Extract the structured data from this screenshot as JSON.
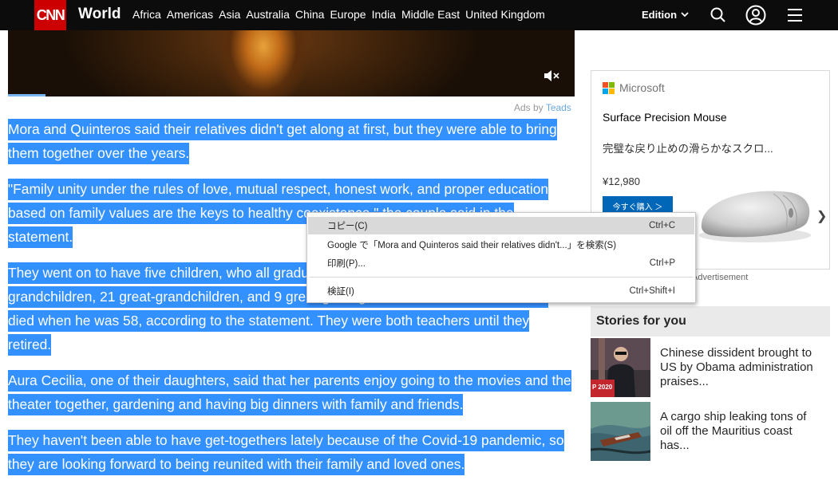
{
  "nav": {
    "logo": "CNN",
    "section": "World",
    "links": [
      "Africa",
      "Americas",
      "Asia",
      "Australia",
      "China",
      "Europe",
      "India",
      "Middle East",
      "United Kingdom"
    ],
    "edition": "Edition",
    "icons": [
      "search-icon",
      "user-icon",
      "menu-icon"
    ]
  },
  "video": {
    "ads_by": "Ads by",
    "ads_provider": "Teads"
  },
  "article": {
    "paragraphs": [
      "Mora and Quinteros said their relatives didn't get along at first, but they were able to bring them together over the years.",
      "\"Family unity under the rules of love, mutual respect, honest work, and proper education based on family values are the keys to healthy coexistence,\" the couple said in the statement.",
      "They went on to have five children, who all graduated from college, as well as 20 grandchildren, 21 great-grandchildren, and 9 great-great-grandchildren. Their eldest son died when he was 58, according to the statement. They were both teachers until they retired.",
      "Aura Cecilia, one of their daughters, said that her parents enjoy going to the movies and the theater together, gardening and having big dinners with family and friends.",
      "They haven't been able to have get-togethers lately because of the Covid-19 pandemic, so they are looking forward to being reunited with their family and loved ones."
    ]
  },
  "ad": {
    "brand": "Microsoft",
    "title": "Surface Precision Mouse",
    "description": "完璧な戻り止めの滑らかなスクロ...",
    "price": "¥12,980",
    "button": "今すぐ購入 ＞",
    "label": "Advertisement",
    "brand_colors": [
      "#f25022",
      "#7fba00",
      "#00a4ef",
      "#ffb900"
    ]
  },
  "stories": {
    "heading": "Stories for you",
    "items": [
      {
        "title": "Chinese dissident brought to US by Obama administration praises..."
      },
      {
        "title": "A cargo ship leaking tons of oil off the Mauritius coast has..."
      }
    ]
  },
  "context_menu": {
    "items": [
      {
        "label": "コピー(C)",
        "shortcut": "Ctrl+C",
        "highlighted": true
      },
      {
        "label": "Google で「Mora and Quinteros said their relatives didn't...」を検索(S)",
        "shortcut": ""
      },
      {
        "label": "印刷(P)...",
        "shortcut": "Ctrl+P"
      },
      {
        "label": "検証(I)",
        "shortcut": "Ctrl+Shift+I"
      }
    ]
  },
  "colors": {
    "selection": "#3390ff",
    "cnn_red": "#cc0000",
    "nav_bg": "#0c0c0c",
    "ms_blue": "#0067b8"
  }
}
